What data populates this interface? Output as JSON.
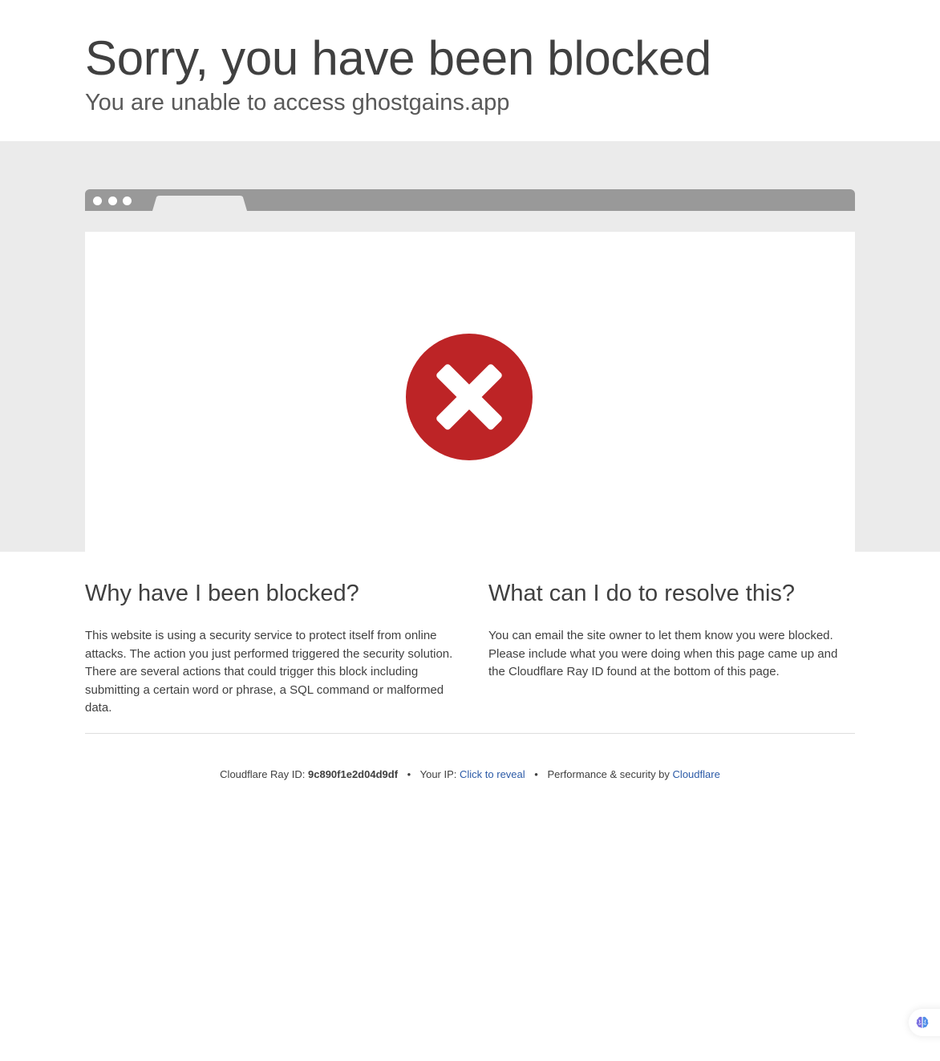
{
  "header": {
    "title": "Sorry, you have been blocked",
    "subtitle": "You are unable to access ghostgains.app"
  },
  "browser_illustration": {
    "status_icon": "blocked-x-icon",
    "accent_color": "#bd2426"
  },
  "why_blocked": {
    "heading": "Why have I been blocked?",
    "body": "This website is using a security service to protect itself from online attacks. The action you just performed triggered the security solution. There are several actions that could trigger this block including submitting a certain word or phrase, a SQL command or malformed data."
  },
  "resolve": {
    "heading": "What can I do to resolve this?",
    "body": "You can email the site owner to let them know you were blocked. Please include what you were doing when this page came up and the Cloudflare Ray ID found at the bottom of this page."
  },
  "footer": {
    "ray_label": "Cloudflare Ray ID:",
    "ray_id": "9c890f1e2d04d9df",
    "separator": "•",
    "ip_label": "Your IP:",
    "ip_reveal": "Click to reveal",
    "perf_label": "Performance & security by",
    "brand_link": "Cloudflare",
    "link_color": "#2c5ba7"
  },
  "corner_widget": {
    "icon": "brain-icon"
  }
}
